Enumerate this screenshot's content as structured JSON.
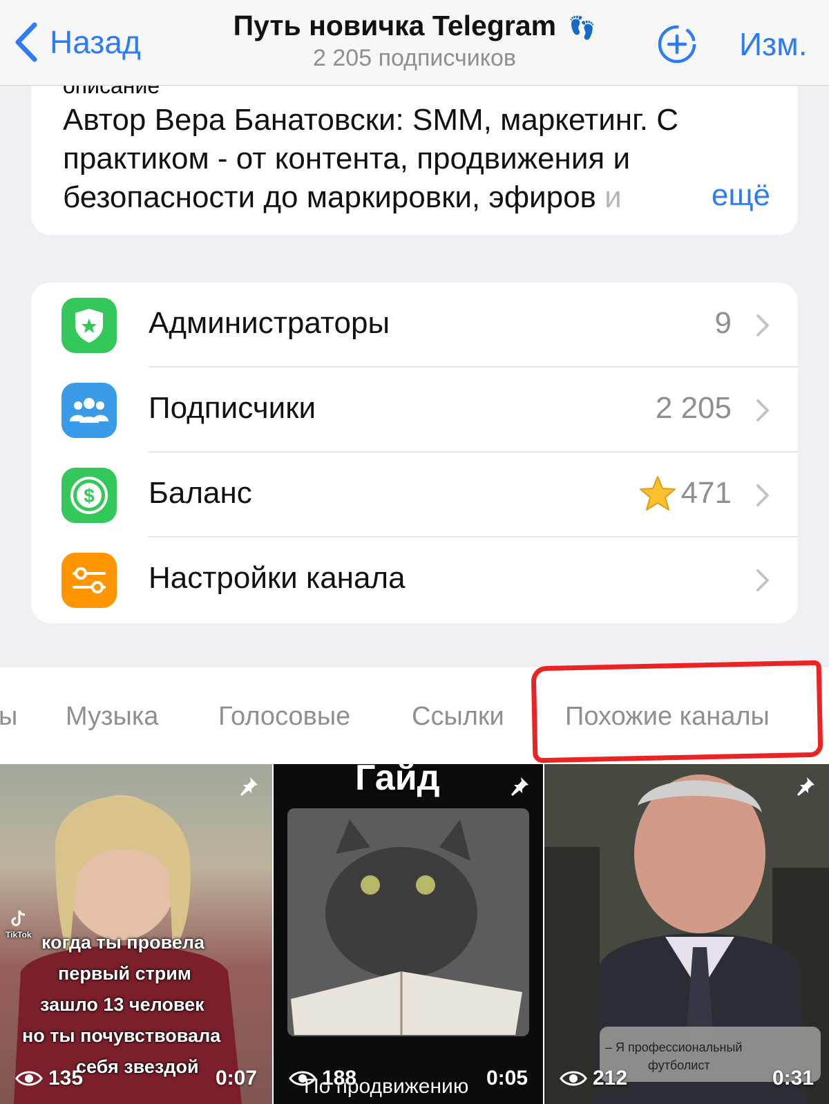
{
  "header": {
    "back_label": "Назад",
    "title": "Путь новичка Telegram",
    "title_emoji": "👣",
    "subtitle": "2 205 подписчиков",
    "edit_label": "Изм."
  },
  "description": {
    "label": "описание",
    "text_main": "Автор Вера Банатовски: SMM, маркетинг. С практиком - от контента, продвижения и безопасности до маркировки, эфиров",
    "text_fade": "и",
    "more_label": "ещё"
  },
  "menu": {
    "items": [
      {
        "label": "Администраторы",
        "value": "9",
        "icon": "shield-star-icon",
        "color": "#34c759"
      },
      {
        "label": "Подписчики",
        "value": "2 205",
        "icon": "people-icon",
        "color": "#3a9be8"
      },
      {
        "label": "Баланс",
        "value": "471",
        "icon": "dollar-icon",
        "color": "#34c759",
        "value_icon": "star-icon"
      },
      {
        "label": "Настройки канала",
        "value": "",
        "icon": "toggles-icon",
        "color": "#ff9500"
      }
    ]
  },
  "tabs": [
    {
      "label": "ы"
    },
    {
      "label": "Музыка"
    },
    {
      "label": "Голосовые"
    },
    {
      "label": "Ссылки"
    },
    {
      "label": "Похожие каналы"
    }
  ],
  "media": [
    {
      "views": "135",
      "duration": "0:07",
      "captions": [
        "когда ты провела",
        "первый стрим",
        "зашло 13 человек",
        "но ты почувствовала",
        "себя звездой"
      ],
      "badge": "TikTok"
    },
    {
      "views": "188",
      "duration": "0:05",
      "top_text": "Гайд",
      "bottom_text": "По продвижению"
    },
    {
      "views": "212",
      "duration": "0:31",
      "subtitle_line1": "– Я профессиональный",
      "subtitle_line2": "футболист"
    }
  ],
  "colors": {
    "accent": "#2d7cf6",
    "highlight": "#ea2424"
  }
}
